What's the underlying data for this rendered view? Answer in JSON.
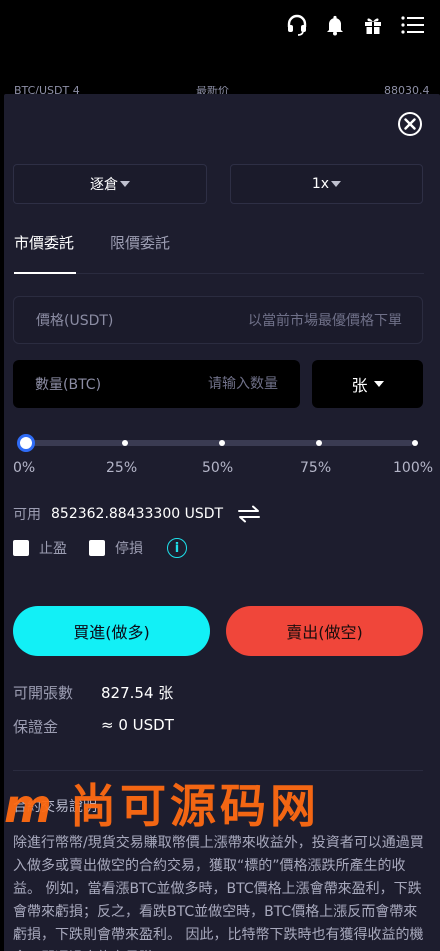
{
  "top_icons": [
    "headset-icon",
    "notification-bell-icon",
    "gift-icon",
    "menu-icon"
  ],
  "peek": {
    "left": "BTC/USDT 4",
    "mid": "最新价",
    "right": "88030.4"
  },
  "order": {
    "margin_mode": "逐倉",
    "leverage": "1x",
    "tabs": [
      {
        "label": "市價委託",
        "active": true
      },
      {
        "label": "限價委託",
        "active": false
      }
    ],
    "price_label": "價格(USDT)",
    "price_placeholder": "以當前市場最優價格下單",
    "qty_label": "數量(BTC)",
    "qty_placeholder": "请输入数量",
    "unit": "张",
    "slider_value_percent": 0,
    "slider_ticks": [
      "0%",
      "25%",
      "50%",
      "75%",
      "100%"
    ],
    "available_label": "可用",
    "available_value": "852362.88433300 USDT",
    "take_profit_label": "止盈",
    "stop_loss_label": "停損",
    "buy_label": "買進(做多)",
    "sell_label": "賣出(做空)",
    "open_contracts_label": "可開張數",
    "open_contracts_value": "827.54 张",
    "margin_label": "保證金",
    "margin_value": "≈ 0 USDT"
  },
  "intro": {
    "title": "合約交易說明",
    "body": "除進行幣幣/現貨交易賺取幣價上漲帶來收益外，投資者可以通過買入做多或賣出做空的合約交易，獲取“標的”價格漲跌所產生的收益。 例如，當看漲BTC並做多時，BTC價格上漲會帶來盈利，下跌會帶來虧損；反之，看跌BTC並做空時，BTC價格上漲反而會帶來虧損，下跌則會帶來盈利。 因此，比特幣下跌時也有獲得收益的機會，即通過合約交易賺"
  },
  "watermark": {
    "m": "m",
    "text": "尚可源码网"
  },
  "colors": {
    "buy": "#12f0f6",
    "sell": "#f0463a",
    "accent": "#1ee0ea",
    "sheet_bg": "#1d1d2e"
  }
}
